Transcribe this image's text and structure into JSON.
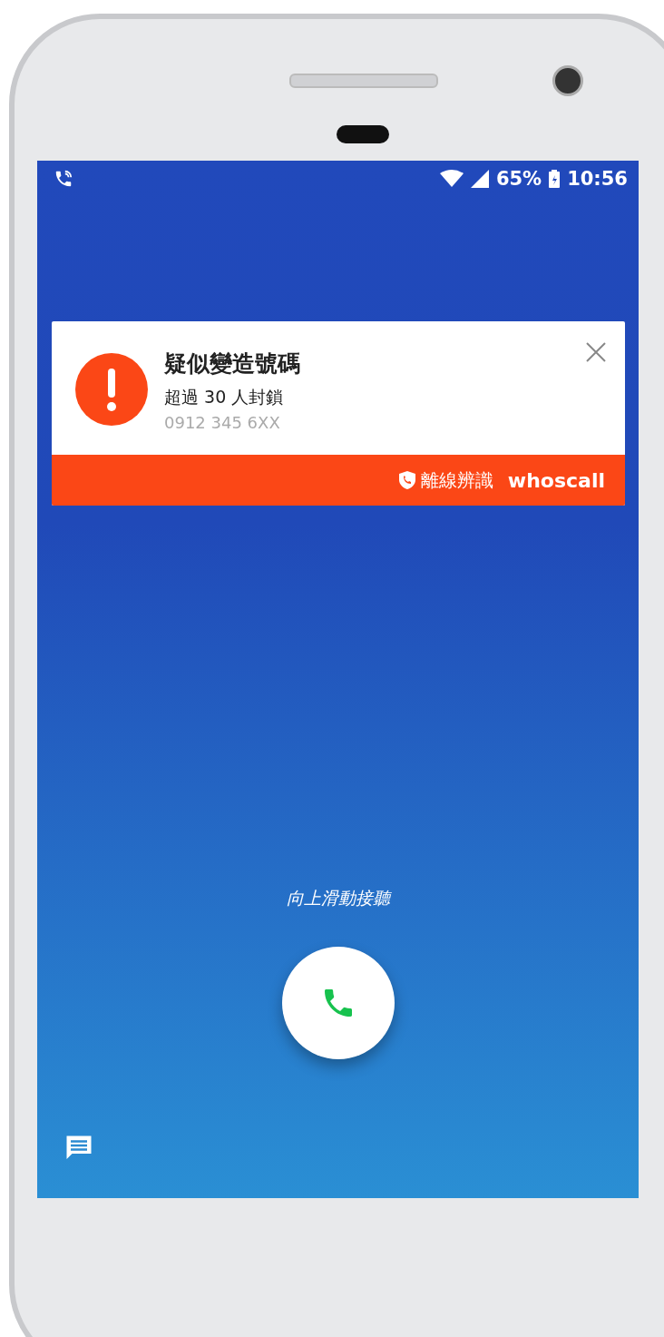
{
  "status_bar": {
    "battery": "65%",
    "time": "10:56"
  },
  "caller_card": {
    "title": "疑似變造號碼",
    "subtitle": "超過 30 人封鎖",
    "number": "0912 345 6XX",
    "badge_label": "離線辨識",
    "brand": "whoscall"
  },
  "answer_hint": "向上滑動接聽"
}
